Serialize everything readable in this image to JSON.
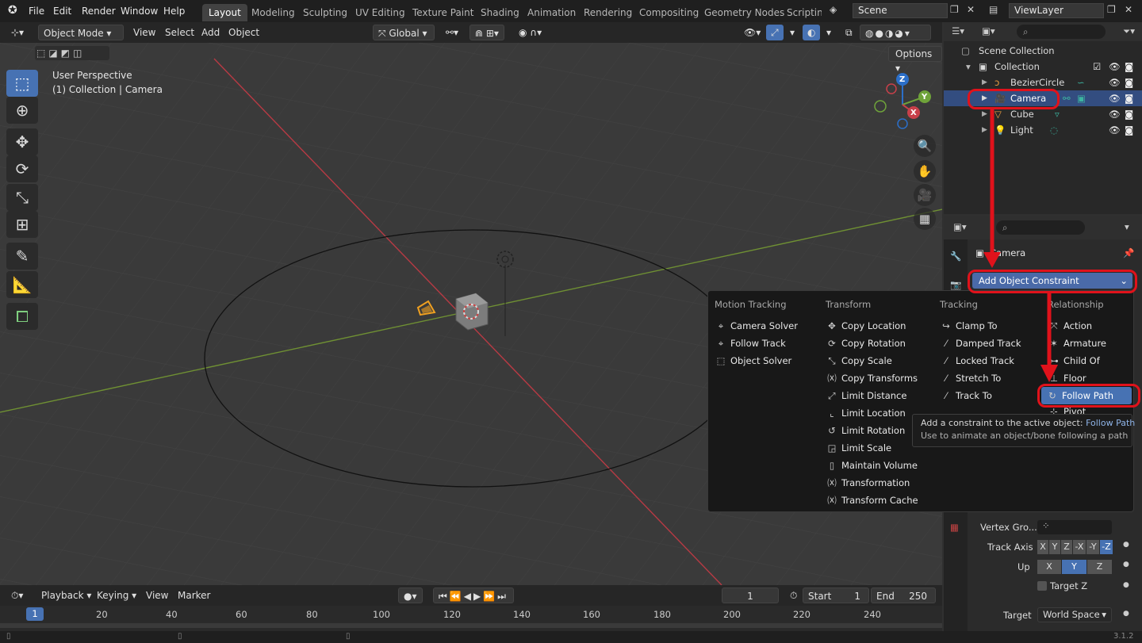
{
  "top_menu": [
    "File",
    "Edit",
    "Render",
    "Window",
    "Help"
  ],
  "workspaces": {
    "items": [
      "Layout",
      "Modeling",
      "Sculpting",
      "UV Editing",
      "Texture Paint",
      "Shading",
      "Animation",
      "Rendering",
      "Compositing",
      "Geometry Nodes",
      "Scripting"
    ],
    "active": "Layout"
  },
  "scene_name": "Scene",
  "view_layer": "ViewLayer",
  "viewport_header": {
    "mode": "Object Mode",
    "menus": [
      "View",
      "Select",
      "Add",
      "Object"
    ],
    "orientation": "Global",
    "options": "Options"
  },
  "viewport_overlay": {
    "perspective": "User Perspective",
    "context": "(1) Collection | Camera"
  },
  "gizmo_axes": {
    "z": "Z",
    "y": "Y",
    "x": "X"
  },
  "outliner": {
    "root": "Scene Collection",
    "collection": "Collection",
    "objects": [
      {
        "name": "BezierCircle",
        "selected": false
      },
      {
        "name": "Camera",
        "selected": true
      },
      {
        "name": "Cube",
        "selected": false
      },
      {
        "name": "Light",
        "selected": false
      }
    ]
  },
  "properties": {
    "object_name": "Camera",
    "add_constraint_label": "Add Object Constraint",
    "vertex_group_label": "Vertex Gro...",
    "track_axis_label": "Track Axis",
    "track_axis_options": [
      "X",
      "Y",
      "Z",
      "-X",
      "-Y",
      "-Z"
    ],
    "track_axis_active": "-Z",
    "up_label": "Up",
    "up_options": [
      "X",
      "Y",
      "Z"
    ],
    "up_active": "Y",
    "target_z_label": "Target Z",
    "target_label": "Target",
    "target_space": "World Space"
  },
  "constraint_menu": {
    "headers": [
      "Motion Tracking",
      "Transform",
      "Tracking",
      "Relationship"
    ],
    "motion_tracking": [
      "Camera Solver",
      "Follow Track",
      "Object Solver"
    ],
    "transform": [
      "Copy Location",
      "Copy Rotation",
      "Copy Scale",
      "Copy Transforms",
      "Limit Distance",
      "Limit Location",
      "Limit Rotation",
      "Limit Scale",
      "Maintain Volume",
      "Transformation",
      "Transform Cache"
    ],
    "tracking": [
      "Clamp To",
      "Damped Track",
      "Locked Track",
      "Stretch To",
      "Track To"
    ],
    "relationship": [
      "Action",
      "Armature",
      "Child Of",
      "Floor",
      "Follow Path",
      "Pivot"
    ],
    "highlighted": "Follow Path"
  },
  "tooltip": {
    "line1_prefix": "Add a constraint to the active object:",
    "line1_name": "Follow Path",
    "line2": "Use to animate an object/bone following a path"
  },
  "timeline": {
    "menus": [
      "Playback",
      "Keying",
      "View",
      "Marker"
    ],
    "current_frame": "1",
    "start_label": "Start",
    "start": "1",
    "end_label": "End",
    "end": "250",
    "ticks": [
      "1",
      "20",
      "40",
      "60",
      "80",
      "100",
      "120",
      "140",
      "160",
      "180",
      "200",
      "220",
      "240"
    ]
  },
  "version": "3.1.2",
  "colors": {
    "accent": "#4772b3",
    "annotation_red": "#e0121b",
    "x_axis": "#c8404a",
    "y_axis": "#7aa03a"
  }
}
